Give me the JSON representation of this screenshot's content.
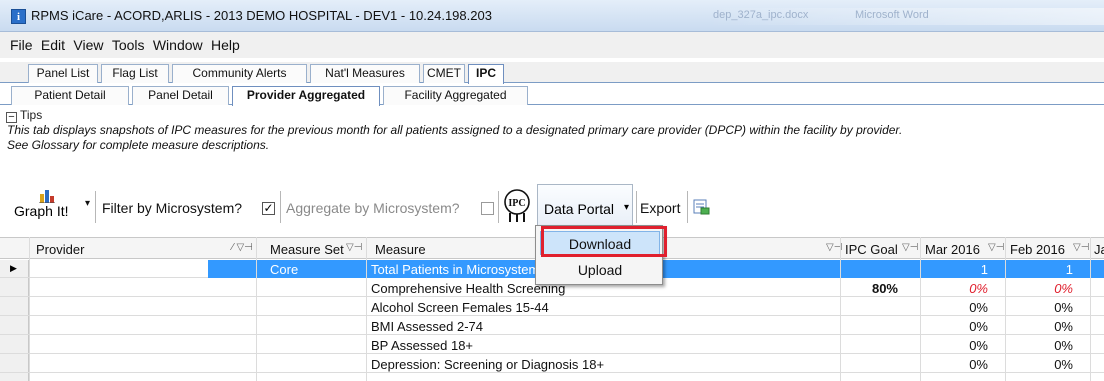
{
  "window": {
    "title": "RPMS iCare - ACORD,ARLIS - 2013 DEMO HOSPITAL - DEV1 - 10.24.198.203",
    "icon_letter": "i",
    "background_doc": "dep_327a_ipc.docx",
    "background_app": "Microsoft Word"
  },
  "menu": [
    "File",
    "Edit",
    "View",
    "Tools",
    "Window",
    "Help"
  ],
  "tabs_top": [
    "Panel List",
    "Flag List",
    "Community Alerts",
    "Nat'l Measures",
    "CMET",
    "IPC"
  ],
  "tabs_top_active": "IPC",
  "tabs_sub": [
    "Patient Detail",
    "Panel Detail",
    "Provider Aggregated",
    "Facility Aggregated"
  ],
  "tabs_sub_active": "Provider Aggregated",
  "tips": {
    "label": "Tips",
    "line1": "This tab displays snapshots of IPC measures for the previous month for all patients assigned to a designated primary care provider (DPCP) within the facility by provider.",
    "line2": "See Glossary for complete measure descriptions."
  },
  "toolbar": {
    "graph_label_1": "Graph",
    "graph_label_2": "It!",
    "filter_label": "Filter by Microsystem?",
    "filter_checked": "✓",
    "aggregate_label": "Aggregate by Microsystem?",
    "ipc_logo": "IPC",
    "data_portal_label": "Data Portal",
    "export_label": "Export"
  },
  "dropdown": {
    "items": [
      "Download",
      "Upload"
    ],
    "hovered": "Download"
  },
  "grid": {
    "columns": [
      "Provider",
      "Measure Set",
      "Measure",
      "IPC Goal",
      "Mar 2016",
      "Feb 2016",
      "Ja"
    ],
    "rows": [
      {
        "measure_set": "Core",
        "measure": "Total Patients in Microsystem",
        "goal": "",
        "mar": "1",
        "feb": "1",
        "selected": true
      },
      {
        "measure_set": "",
        "measure": "Comprehensive Health Screening",
        "goal": "80%",
        "mar": "0%",
        "feb": "0%",
        "red": true
      },
      {
        "measure_set": "",
        "measure": "Alcohol Screen Females 15-44",
        "goal": "",
        "mar": "0%",
        "feb": "0%"
      },
      {
        "measure_set": "",
        "measure": "BMI Assessed 2-74",
        "goal": "",
        "mar": "0%",
        "feb": "0%"
      },
      {
        "measure_set": "",
        "measure": "BP Assessed 18+",
        "goal": "",
        "mar": "0%",
        "feb": "0%"
      },
      {
        "measure_set": "",
        "measure": "Depression: Screening or Diagnosis 18+",
        "goal": "",
        "mar": "0%",
        "feb": "0%"
      }
    ]
  },
  "colors": {
    "selection": "#3399ff",
    "alert_red": "#e0202e",
    "hover_blue": "#cde4fa"
  }
}
